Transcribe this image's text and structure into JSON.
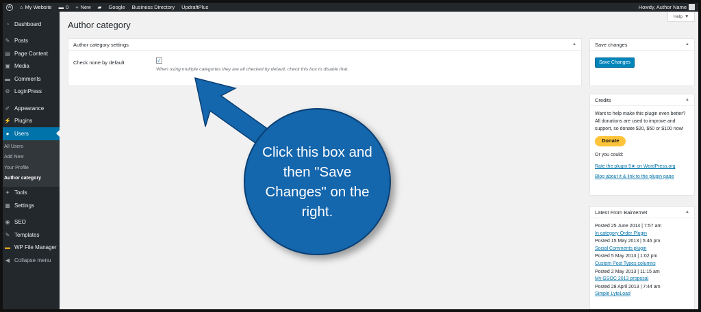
{
  "adminbar": {
    "site_name": "My Website",
    "comments_count": "0",
    "new_label": "New",
    "links": [
      "Google",
      "Business Directory",
      "UpdraftPlus"
    ],
    "greeting": "Howdy, Author Name"
  },
  "sidebar": {
    "items": [
      {
        "label": "Dashboard",
        "icon": "dashboard-icon",
        "glyph": "◔"
      },
      {
        "label": "Posts",
        "icon": "pin-icon",
        "glyph": "✎"
      },
      {
        "label": "Page Content",
        "icon": "page-icon",
        "glyph": "▤"
      },
      {
        "label": "Media",
        "icon": "media-icon",
        "glyph": "▣"
      },
      {
        "label": "Comments",
        "icon": "comment-icon",
        "glyph": "▬"
      },
      {
        "label": "LoginPress",
        "icon": "gear-icon",
        "glyph": "⚙"
      },
      {
        "label": "Appearance",
        "icon": "brush-icon",
        "glyph": "✐"
      },
      {
        "label": "Plugins",
        "icon": "plug-icon",
        "glyph": "⚡"
      },
      {
        "label": "Users",
        "icon": "user-icon",
        "glyph": "●"
      },
      {
        "label": "Tools",
        "icon": "wrench-icon",
        "glyph": "✦"
      },
      {
        "label": "Settings",
        "icon": "settings-icon",
        "glyph": "▦"
      },
      {
        "label": "SEO",
        "icon": "seo-icon",
        "glyph": "◉"
      },
      {
        "label": "Templates",
        "icon": "templates-icon",
        "glyph": "✎"
      },
      {
        "label": "WP File Manager",
        "icon": "folder-icon",
        "glyph": "▬"
      },
      {
        "label": "Collapse menu",
        "icon": "collapse-icon",
        "glyph": "◀"
      }
    ],
    "submenu": [
      "All Users",
      "Add New",
      "Your Profile",
      "Author category"
    ]
  },
  "page": {
    "title": "Author category",
    "help_label": "Help"
  },
  "settings_box": {
    "title": "Author category settings",
    "field_label": "Check none by default",
    "checked": true,
    "description": "When using multiple categories they are all checked by default, check this box to disable that."
  },
  "save_box": {
    "title": "Save changes",
    "button_label": "Save Changes"
  },
  "credits_box": {
    "title": "Credits",
    "text": "Want to help make this plugin even better? All donations are used to improve and support, so donate $20, $50 or $100 now!",
    "donate_label": "Donate",
    "or_label": "Or you could:",
    "links": [
      "Rate the plugin 5★ on WordPress.org",
      "Blog about it & link to the plugin page"
    ]
  },
  "news_box": {
    "title": "Latest From Bainternet",
    "posts": [
      {
        "date": "Posted 25 June 2014 | 7:57 am",
        "title": "In category Order Plugin"
      },
      {
        "date": "Posted 15 May 2013 | 5:46 pm",
        "title": "Social Comments plugin"
      },
      {
        "date": "Posted 5 May 2013 | 1:02 pm",
        "title": "Custom Post Types columns"
      },
      {
        "date": "Posted 2 May 2013 | 11:15 am",
        "title": "My GSOC 2013 proposal"
      },
      {
        "date": "Posted 28 April 2013 | 7:44 am",
        "title": "Simple LyteLoad"
      }
    ]
  },
  "callout": {
    "text": "Click this box and then \"Save Changes\" on the right.",
    "color": "#1466ad"
  }
}
